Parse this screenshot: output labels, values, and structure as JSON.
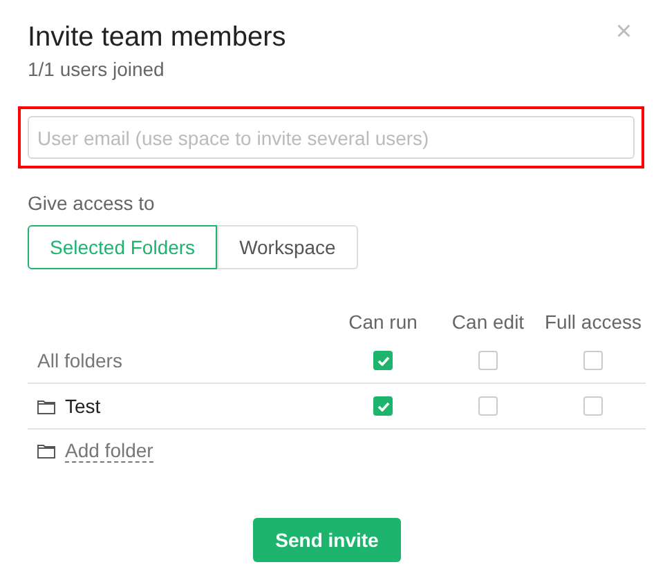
{
  "dialog": {
    "title": "Invite team members",
    "subtitle": "1/1 users joined",
    "close": "×"
  },
  "email_field": {
    "placeholder": "User email (use space to invite several users)",
    "highlighted": true
  },
  "access": {
    "label": "Give access to",
    "options": [
      {
        "label": "Selected Folders",
        "selected": true
      },
      {
        "label": "Workspace",
        "selected": false
      }
    ]
  },
  "table": {
    "columns": [
      "Can run",
      "Can edit",
      "Full access"
    ],
    "rows": [
      {
        "kind": "all",
        "name": "All folders",
        "checks": [
          true,
          false,
          false
        ]
      },
      {
        "kind": "folder",
        "name": "Test",
        "checks": [
          true,
          false,
          false
        ]
      }
    ]
  },
  "add_folder": "Add folder",
  "send_button": "Send invite"
}
